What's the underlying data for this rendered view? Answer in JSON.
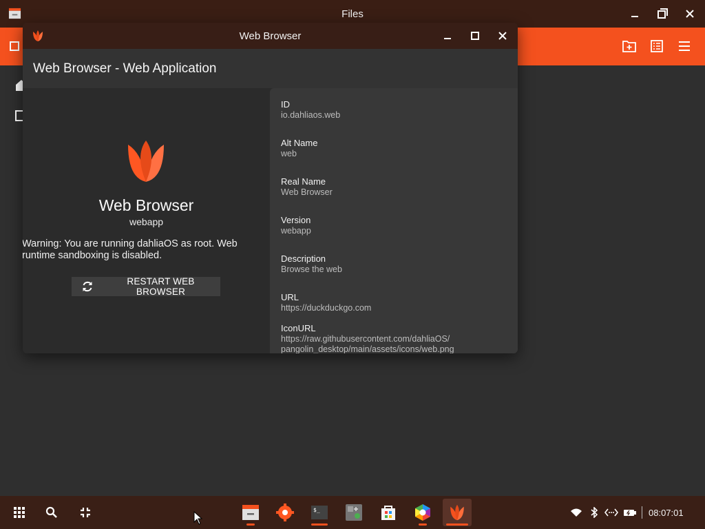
{
  "files": {
    "title": "Files"
  },
  "browser": {
    "window_title": "Web Browser",
    "header_title": "Web Browser - Web Application",
    "app_name": "Web Browser",
    "app_subtitle": "webapp",
    "warning": "Warning: You are running dahliaOS as root. Web runtime sandboxing is disabled.",
    "restart_label": "RESTART WEB BROWSER",
    "fields": [
      {
        "key": "ID",
        "value": "io.dahliaos.web"
      },
      {
        "key": "Alt Name",
        "value": "web"
      },
      {
        "key": "Real Name",
        "value": "Web Browser"
      },
      {
        "key": "Version",
        "value": "webapp"
      },
      {
        "key": "Description",
        "value": "Browse the web"
      },
      {
        "key": "URL",
        "value": "https://duckduckgo.com"
      },
      {
        "key": "IconURL",
        "value": "https://raw.githubusercontent.com/dahliaOS/",
        "value2": "pangolin_desktop/main/assets/icons/web.png"
      }
    ]
  },
  "taskbar": {
    "clock": "08:07:01",
    "dock": [
      "files-app",
      "settings-app",
      "terminal-app",
      "calculator-app",
      "store-app",
      "graft-app",
      "web-browser-app"
    ]
  },
  "colors": {
    "accent": "#f4511e",
    "titlebar": "#3a1e14",
    "panel": "#383838"
  }
}
